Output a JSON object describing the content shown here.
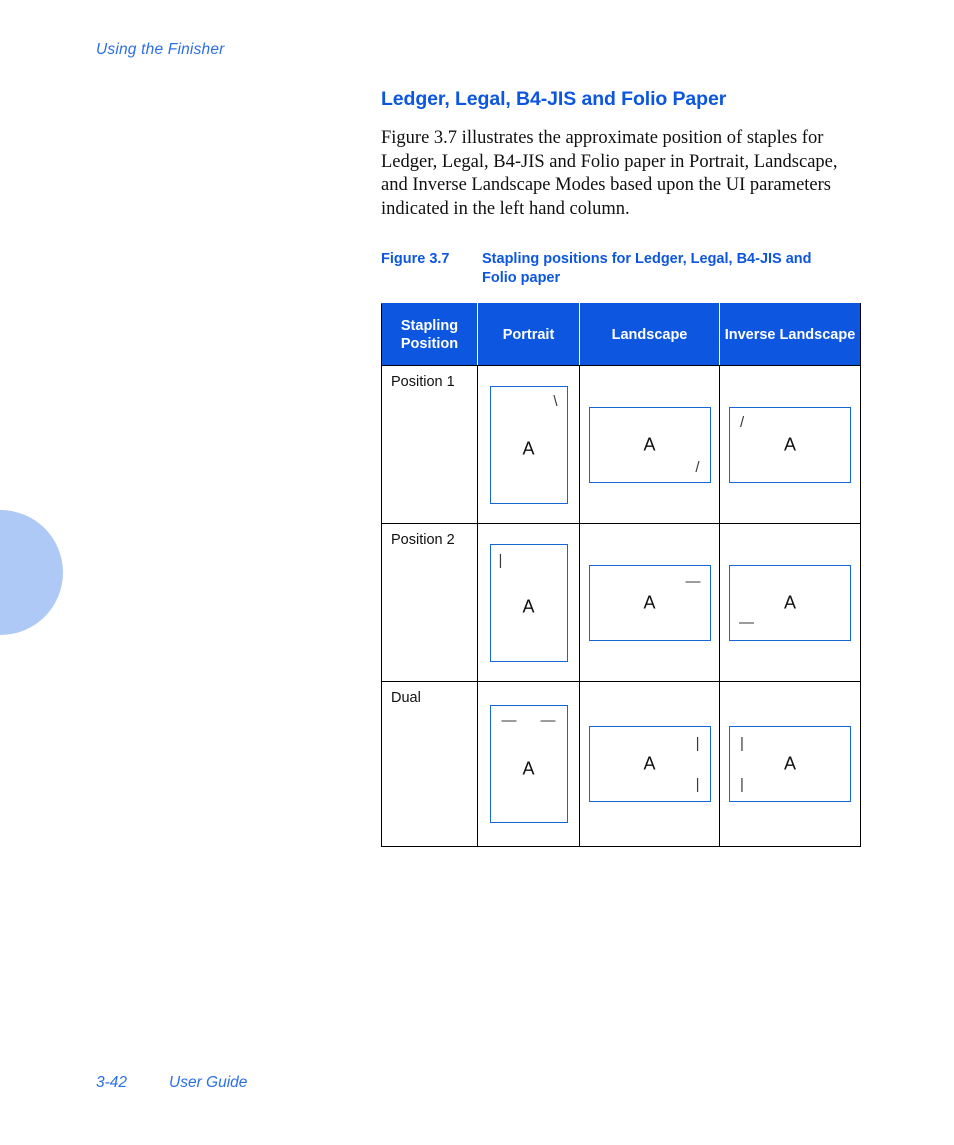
{
  "running_header": "Using the Finisher",
  "section": {
    "title": "Ledger, Legal, B4-JIS and Folio Paper",
    "paragraph": "Figure 3.7 illustrates the approximate position of staples for Ledger, Legal, B4-JIS and Folio paper in Portrait, Landscape, and Inverse Landscape Modes based upon the UI parameters indicated in the left hand column."
  },
  "figure": {
    "number": "Figure 3.7",
    "caption": "Stapling positions for Ledger, Legal, B4-JIS and Folio paper"
  },
  "table": {
    "headers": [
      "Stapling Position",
      "Portrait",
      "Landscape",
      "Inverse Landscape"
    ],
    "page_letter": "A",
    "rows": [
      {
        "position": "Position 1",
        "portrait": {
          "mark": "\\",
          "mark_name": "staple-mark-backslash-top-right"
        },
        "landscape": {
          "mark": "/",
          "mark_name": "staple-mark-slash-bottom-right"
        },
        "inverse_landscape": {
          "mark": "/",
          "mark_name": "staple-mark-slash-top-left"
        }
      },
      {
        "position": "Position 2",
        "portrait": {
          "mark": "|",
          "mark_name": "staple-mark-bar-top-left"
        },
        "landscape": {
          "mark": "—",
          "mark_name": "staple-mark-dash-top-right"
        },
        "inverse_landscape": {
          "mark": "—",
          "mark_name": "staple-mark-dash-bottom-left"
        }
      },
      {
        "position": "Dual",
        "portrait": {
          "mark": "—",
          "mark_name": "staple-mark-dual-dashes-top"
        },
        "landscape": {
          "mark": "|",
          "mark_name": "staple-mark-dual-bars-right"
        },
        "inverse_landscape": {
          "mark": "|",
          "mark_name": "staple-mark-dual-bars-left"
        }
      }
    ]
  },
  "footer": {
    "page_number": "3-42",
    "document_title": "User Guide"
  },
  "colors": {
    "accent_blue": "#0d56e0",
    "link_blue": "#2b6fe8",
    "page_outline": "#1565d8",
    "circle": "#afc9f6"
  }
}
